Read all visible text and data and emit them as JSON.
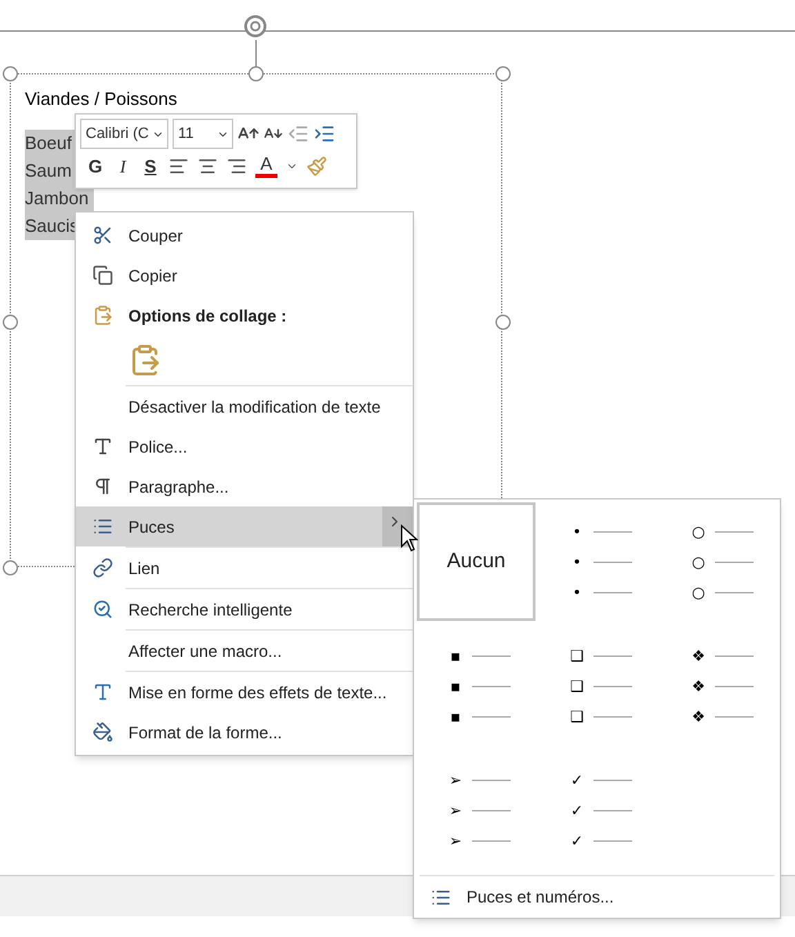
{
  "text_box": {
    "title": "Viandes / Poissons",
    "lines": [
      "Boeuf",
      "Saum",
      "Jambon",
      "Saucis"
    ]
  },
  "mini_toolbar": {
    "font": "Calibri (C",
    "size": "11",
    "bold": "G",
    "italic": "I",
    "underline": "S",
    "font_color": "A"
  },
  "context_menu": {
    "items": [
      {
        "kind": "item",
        "label": "Couper",
        "selected": false
      },
      {
        "kind": "item",
        "label": "Copier",
        "selected": false
      },
      {
        "kind": "header",
        "label": "Options de collage :"
      },
      {
        "kind": "paste"
      },
      {
        "kind": "separator"
      },
      {
        "kind": "item",
        "label": "Désactiver la modification de texte",
        "selected": false
      },
      {
        "kind": "item",
        "label": "Police...",
        "selected": false
      },
      {
        "kind": "item",
        "label": "Paragraphe...",
        "selected": false
      },
      {
        "kind": "submenu",
        "label": "Puces",
        "selected": true
      },
      {
        "kind": "separator"
      },
      {
        "kind": "item",
        "label": "Lien",
        "selected": false
      },
      {
        "kind": "separator"
      },
      {
        "kind": "item",
        "label": "Recherche intelligente",
        "selected": false
      },
      {
        "kind": "separator"
      },
      {
        "kind": "item",
        "label": "Affecter une macro...",
        "selected": false
      },
      {
        "kind": "separator"
      },
      {
        "kind": "item",
        "label": "Mise en forme des effets de texte...",
        "selected": false
      },
      {
        "kind": "item",
        "label": "Format de la forme...",
        "selected": false
      }
    ]
  },
  "bullets_submenu": {
    "styles": [
      {
        "kind": "none",
        "label": "Aucun",
        "selected": true
      },
      {
        "kind": "bullets",
        "glyphs": [
          "•",
          "•",
          "•"
        ],
        "selected": false
      },
      {
        "kind": "bullets",
        "glyphs": [
          "○",
          "○",
          "○"
        ],
        "selected": false
      },
      {
        "kind": "bullets",
        "glyphs": [
          "▪",
          "▪",
          "▪"
        ],
        "selected": false
      },
      {
        "kind": "bullets",
        "glyphs": [
          "❑",
          "❑",
          "❑"
        ],
        "selected": false
      },
      {
        "kind": "bullets",
        "glyphs": [
          "❖",
          "❖",
          "❖"
        ],
        "selected": false
      },
      {
        "kind": "bullets",
        "glyphs": [
          "➢",
          "➢",
          "➢"
        ],
        "selected": false
      },
      {
        "kind": "bullets",
        "glyphs": [
          "✓",
          "✓",
          "✓"
        ],
        "selected": false
      }
    ],
    "footer": "Puces et numéros..."
  }
}
